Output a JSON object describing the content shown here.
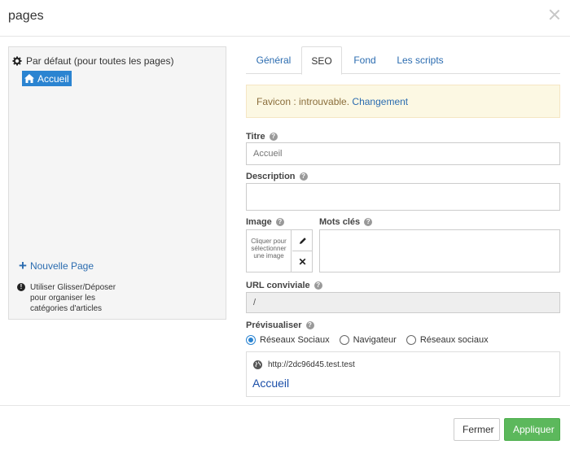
{
  "window": {
    "title": "pages"
  },
  "tree": {
    "root_label": "Par défaut (pour toutes les pages)",
    "child_label": "Accueil",
    "new_page_label": "Nouvelle Page",
    "hint": "Utiliser Glisser/Déposer pour organiser les catégories d'articles"
  },
  "tabs": [
    "Général",
    "SEO",
    "Fond",
    "Les scripts"
  ],
  "alert": {
    "text": "Favicon : introuvable.",
    "link": "Changement"
  },
  "form": {
    "titre_label": "Titre",
    "titre_placeholder": "Accueil",
    "description_label": "Description",
    "image_label": "Image",
    "image_pick_text": "Cliquer pour sélectionner une image",
    "motscles_label": "Mots clés",
    "url_label": "URL conviviale",
    "url_value": "/",
    "preview_label": "Prévisualiser"
  },
  "preview_options": [
    "Réseaux Sociaux",
    "Navigateur",
    "Réseaux sociaux"
  ],
  "preview_selected": "Réseaux Sociaux",
  "preview": {
    "url": "http://2dc96d45.test.test",
    "title": "Accueil"
  },
  "footer": {
    "close_label": "Fermer",
    "apply_label": "Appliquer"
  },
  "colors": {
    "accent": "#2b84d1",
    "apply": "#5cb85c",
    "alert_bg": "#fcf8e3"
  }
}
